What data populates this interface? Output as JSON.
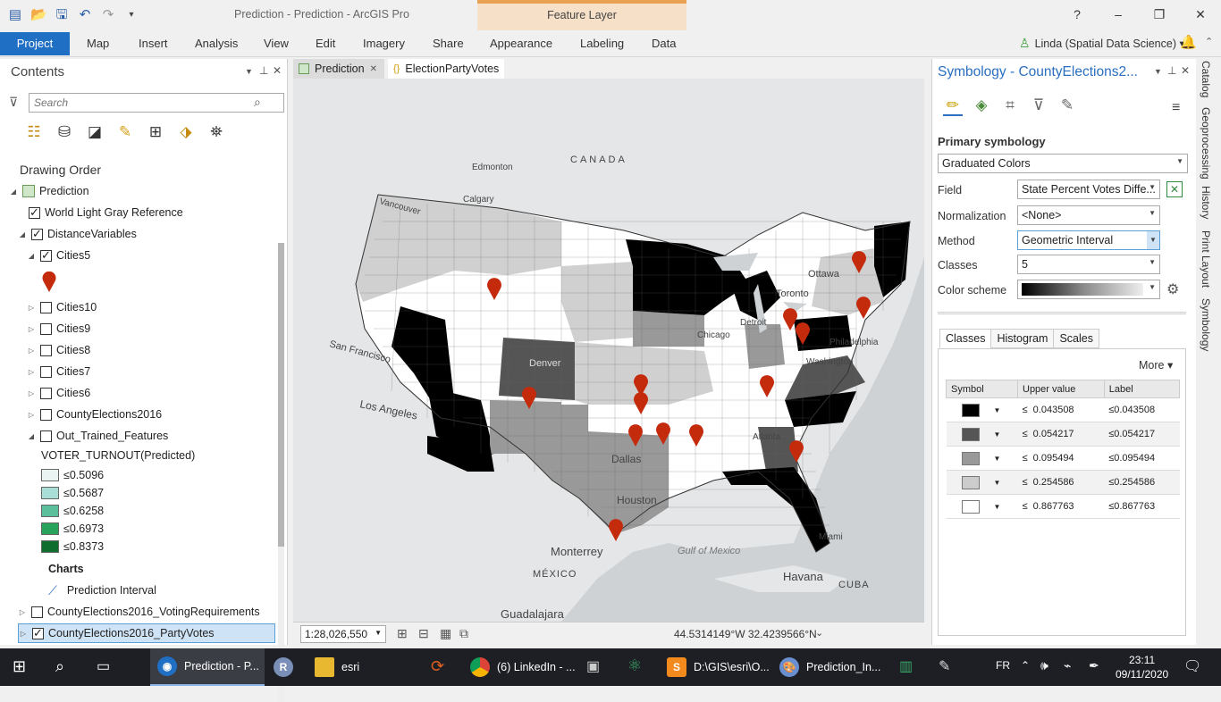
{
  "window": {
    "title": "Prediction - Prediction - ArcGIS Pro",
    "contextual_tab_group": "Feature Layer",
    "controls": [
      "?",
      "–",
      "❐",
      "✕"
    ]
  },
  "ribbon": {
    "tabs": [
      "Project",
      "Map",
      "Insert",
      "Analysis",
      "View",
      "Edit",
      "Imagery",
      "Share",
      "Appearance",
      "Labeling",
      "Data"
    ],
    "user": "Linda (Spatial Data Science) ▾"
  },
  "contents": {
    "title": "Contents",
    "search_placeholder": "Search",
    "drawing_order": "Drawing Order",
    "layers": {
      "map": "Prediction",
      "basemap": "World Light Gray Reference",
      "group": "DistanceVariables",
      "cities5": "Cities5",
      "cities10": "Cities10",
      "cities9": "Cities9",
      "cities8": "Cities8",
      "cities7": "Cities7",
      "cities6": "Cities6",
      "county": "CountyElections2016",
      "trained": "Out_Trained_Features",
      "trained_field": "VOTER_TURNOUT(Predicted)",
      "legend": [
        "≤0.5096",
        "≤0.5687",
        "≤0.6258",
        "≤0.6973",
        "≤0.8373"
      ],
      "charts": "Charts",
      "chart_item": "Prediction Interval",
      "voting": "CountyElections2016_VotingRequirements",
      "party": "CountyElections2016_PartyVotes"
    },
    "legend_colors": [
      "#eaf5f3",
      "#a8ded6",
      "#5bbf9c",
      "#27a35c",
      "#0f6e2d"
    ]
  },
  "map_view": {
    "tabs": [
      "Prediction",
      "ElectionPartyVotes"
    ],
    "scale": "1:28,026,550",
    "coordinates": "44.5314149°W 32.4239566°N",
    "place_labels": [
      "CANADA",
      "Edmonton",
      "Calgary",
      "Vancouver",
      "Ottawa",
      "Toronto",
      "Detroit",
      "Chicago",
      "Philadelphia",
      "Washington",
      "San Francisco",
      "Los Angeles",
      "Denver",
      "Dallas",
      "Houston",
      "Atlanta",
      "Miami",
      "Monterrey",
      "MÉXICO",
      "Gulf of Mexico",
      "Havana",
      "CUBA",
      "Guadalajara"
    ]
  },
  "symbology": {
    "title": "Symbology - CountyElections2...",
    "primary": "Primary symbology",
    "renderer": "Graduated Colors",
    "field_label": "Field",
    "field_value": "State Percent Votes Diffe...",
    "normalization_label": "Normalization",
    "normalization_value": "<None>",
    "method_label": "Method",
    "method_value": "Geometric Interval",
    "classes_label": "Classes",
    "classes_value": "5",
    "color_scheme_label": "Color scheme",
    "tabs": [
      "Classes",
      "Histogram",
      "Scales"
    ],
    "more": "More ▾",
    "table_headers": [
      "Symbol",
      "Upper value",
      "Label"
    ],
    "rows": [
      {
        "op": "≤",
        "upper": "0.043508",
        "label": "≤0.043508",
        "color": "#000000"
      },
      {
        "op": "≤",
        "upper": "0.054217",
        "label": "≤0.054217",
        "color": "#555555"
      },
      {
        "op": "≤",
        "upper": "0.095494",
        "label": "≤0.095494",
        "color": "#999999"
      },
      {
        "op": "≤",
        "upper": "0.254586",
        "label": "≤0.254586",
        "color": "#cccccc"
      },
      {
        "op": "≤",
        "upper": "0.867763",
        "label": "≤0.867763",
        "color": "#ffffff"
      }
    ]
  },
  "dock": [
    "Catalog",
    "Geoprocessing",
    "History",
    "Print Layout",
    "Symbology"
  ],
  "taskbar": {
    "items": [
      "Prediction - P...",
      "esri",
      "(6) LinkedIn - ...",
      "D:\\GIS\\esri\\O...",
      "Prediction_In..."
    ],
    "lang": "FR",
    "time": "23:11",
    "date": "09/11/2020"
  }
}
